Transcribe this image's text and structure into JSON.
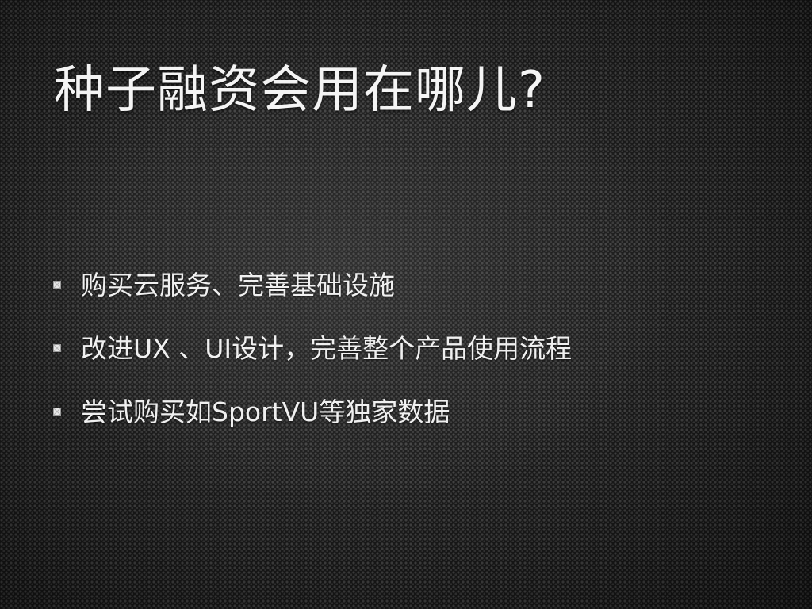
{
  "slide": {
    "title": "种子融资会用在哪儿?",
    "bullets": [
      "购买云服务、完善基础设施",
      "改进UX 、UI设计，完善整个产品使用流程",
      "尝试购买如SportVU等独家数据"
    ],
    "bullet_icon": "square-bullet-icon",
    "colors": {
      "background": "#1a1a1a",
      "text": "#f0f0f0"
    }
  }
}
